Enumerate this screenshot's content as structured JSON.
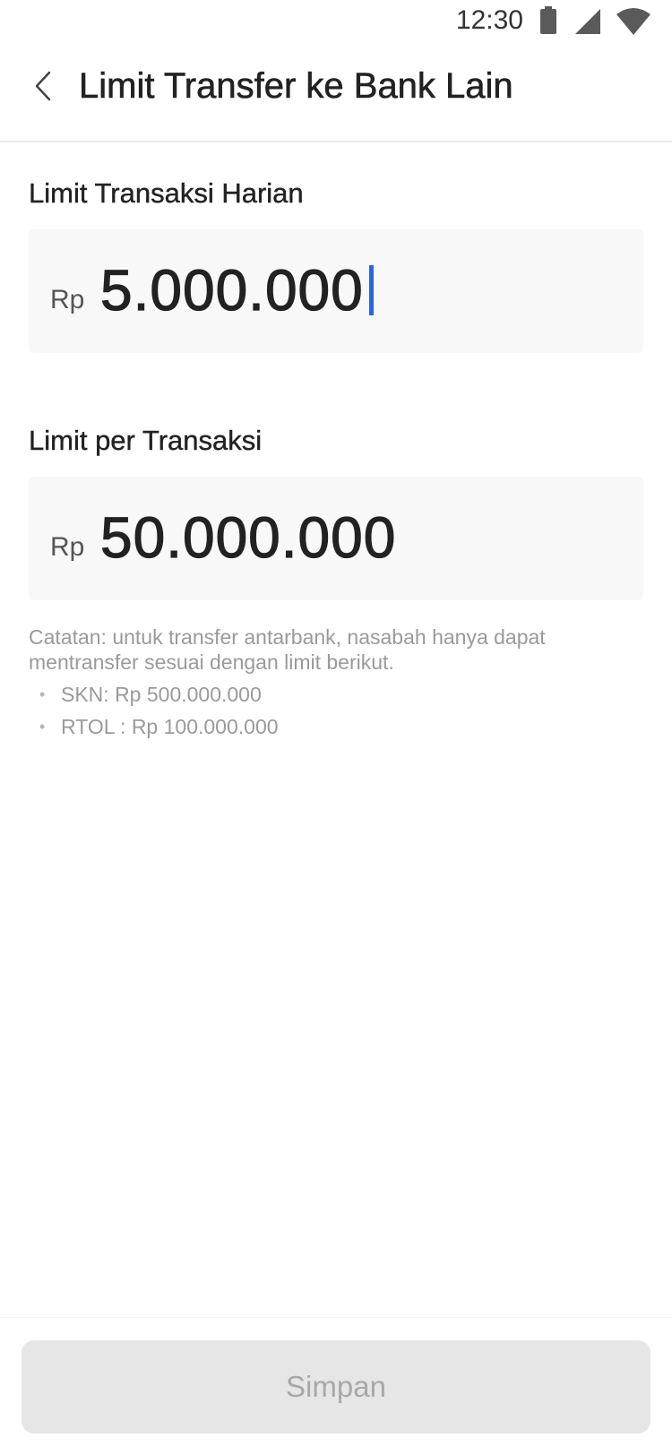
{
  "status_bar": {
    "time": "12:30",
    "icons": [
      "battery-icon",
      "signal-icon",
      "wifi-icon"
    ]
  },
  "header": {
    "title": "Limit Transfer ke Bank Lain",
    "back_icon": "chevron-left-icon"
  },
  "daily_limit": {
    "label": "Limit Transaksi Harian",
    "currency": "Rp",
    "value": "5.000.000",
    "focused": true
  },
  "per_transaction_limit": {
    "label": "Limit per Transaksi",
    "currency": "Rp",
    "value": "50.000.000"
  },
  "note": {
    "text": "Catatan: untuk transfer antarbank, nasabah hanya dapat mentransfer sesuai dengan limit berikut.",
    "items": [
      "SKN: Rp 500.000.000",
      "RTOL : Rp 100.000.000"
    ]
  },
  "footer": {
    "save_label": "Simpan",
    "save_enabled": false
  },
  "colors": {
    "caret": "#2a62e8",
    "input_bg": "#f8f8f8",
    "button_disabled_bg": "#e6e6e6",
    "button_disabled_text": "#a8a8a8",
    "note_text": "#9a9a9a"
  }
}
